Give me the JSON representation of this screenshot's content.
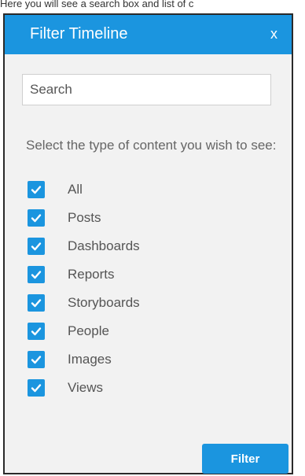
{
  "caption": "Here you will see a search box and list of c",
  "dialog": {
    "title": "Filter Timeline",
    "close_label": "x",
    "search": {
      "placeholder": "Search",
      "value": ""
    },
    "prompt": "Select the type of content you wish to see:",
    "options": [
      {
        "label": "All",
        "checked": true
      },
      {
        "label": "Posts",
        "checked": true
      },
      {
        "label": "Dashboards",
        "checked": true
      },
      {
        "label": "Reports",
        "checked": true
      },
      {
        "label": "Storyboards",
        "checked": true
      },
      {
        "label": "People",
        "checked": true
      },
      {
        "label": "Images",
        "checked": true
      },
      {
        "label": "Views",
        "checked": true
      }
    ],
    "filter_button_label": "Filter"
  },
  "colors": {
    "accent": "#1b95df",
    "panel_background": "#f2f2f2",
    "text_muted": "#666666"
  },
  "icons": {
    "checkbox_mark": "checkmark-icon"
  }
}
